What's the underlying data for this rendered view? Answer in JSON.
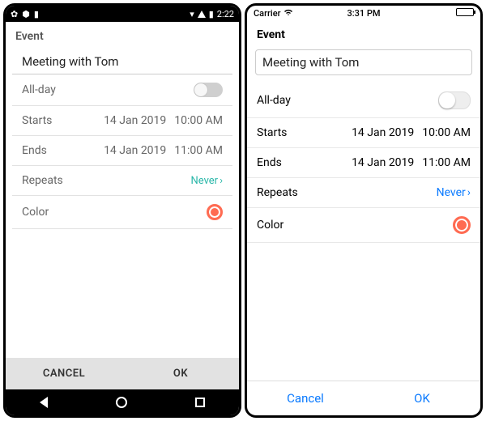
{
  "android": {
    "status": {
      "time": "2:22"
    },
    "header": "Event",
    "title": "Meeting with Tom",
    "allday_label": "All-day",
    "starts_label": "Starts",
    "starts_date": "14 Jan 2019",
    "starts_time": "10:00 AM",
    "ends_label": "Ends",
    "ends_date": "14 Jan 2019",
    "ends_time": "11:00 AM",
    "repeats_label": "Repeats",
    "repeats_value": "Never",
    "color_label": "Color",
    "color_value": "#ff6b52",
    "cancel": "CANCEL",
    "ok": "OK"
  },
  "ios": {
    "status": {
      "carrier": "Carrier",
      "time": "3:31 PM"
    },
    "header": "Event",
    "title": "Meeting with Tom",
    "allday_label": "All-day",
    "starts_label": "Starts",
    "starts_date": "14 Jan 2019",
    "starts_time": "10:00 AM",
    "ends_label": "Ends",
    "ends_date": "14 Jan 2019",
    "ends_time": "11:00 AM",
    "repeats_label": "Repeats",
    "repeats_value": "Never",
    "color_label": "Color",
    "color_value": "#ff6b52",
    "cancel": "Cancel",
    "ok": "OK"
  }
}
